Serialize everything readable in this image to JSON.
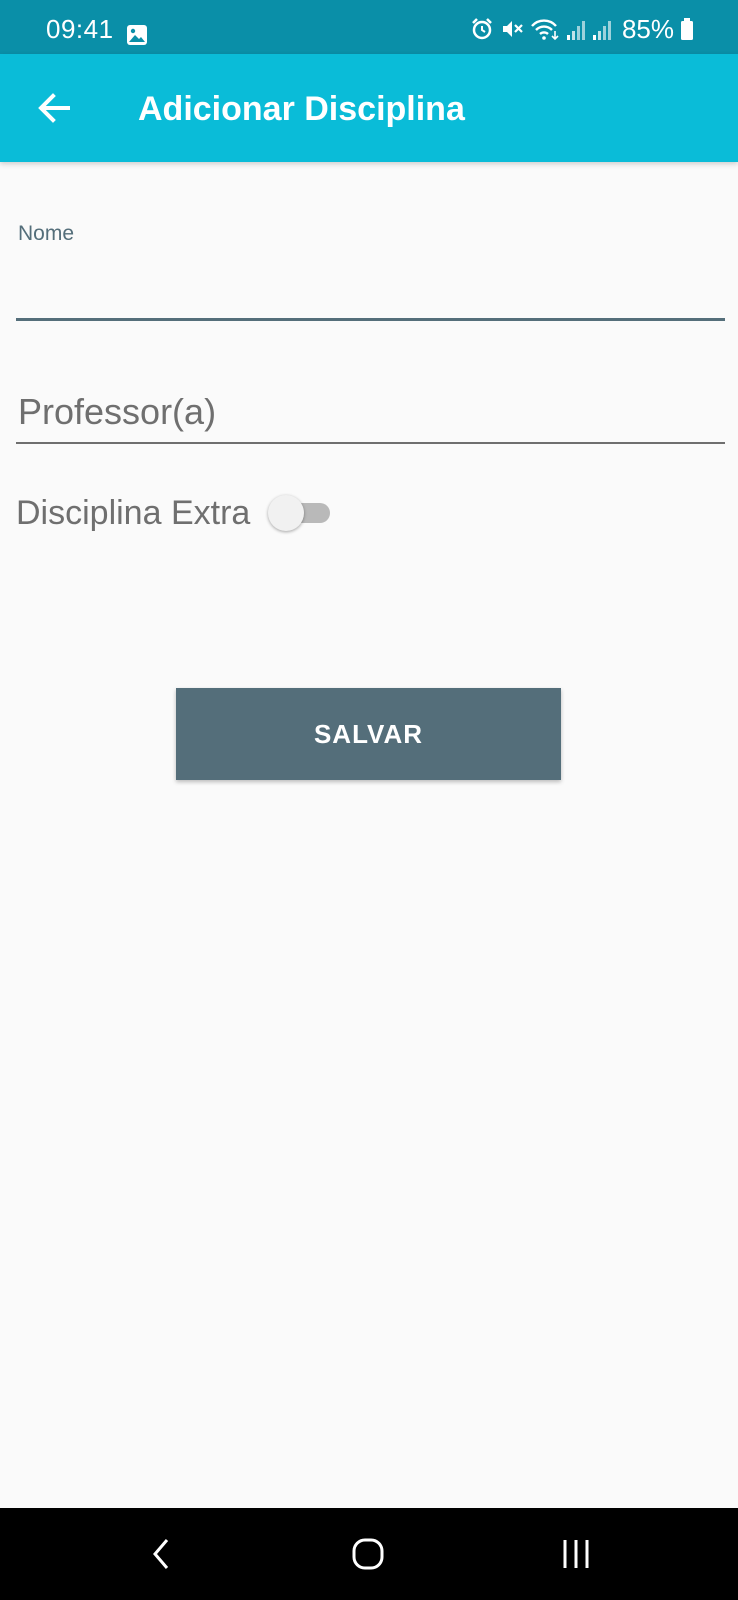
{
  "status_bar": {
    "time": "09:41",
    "battery": "85%",
    "icons": [
      "gallery-icon",
      "alarm-icon",
      "mute-icon",
      "wifi-icon",
      "signal-icon",
      "signal-icon",
      "battery-icon"
    ]
  },
  "app_bar": {
    "title": "Adicionar Disciplina",
    "back_icon": "arrow-back-icon"
  },
  "form": {
    "nome_label": "Nome",
    "nome_value": "",
    "professor_placeholder": "Professor(a)",
    "professor_value": "",
    "extra_label": "Disciplina Extra",
    "extra_enabled": false,
    "save_label": "SALVAR"
  },
  "nav_bar": {
    "icons": [
      "nav-back-icon",
      "nav-home-icon",
      "nav-recents-icon"
    ]
  },
  "colors": {
    "status_bar": "#0a8fa8",
    "app_bar": "#0abcd8",
    "background": "#fafafa",
    "button": "#546e7a",
    "label": "#546e7a",
    "switch_track": "#b9b9b9"
  }
}
